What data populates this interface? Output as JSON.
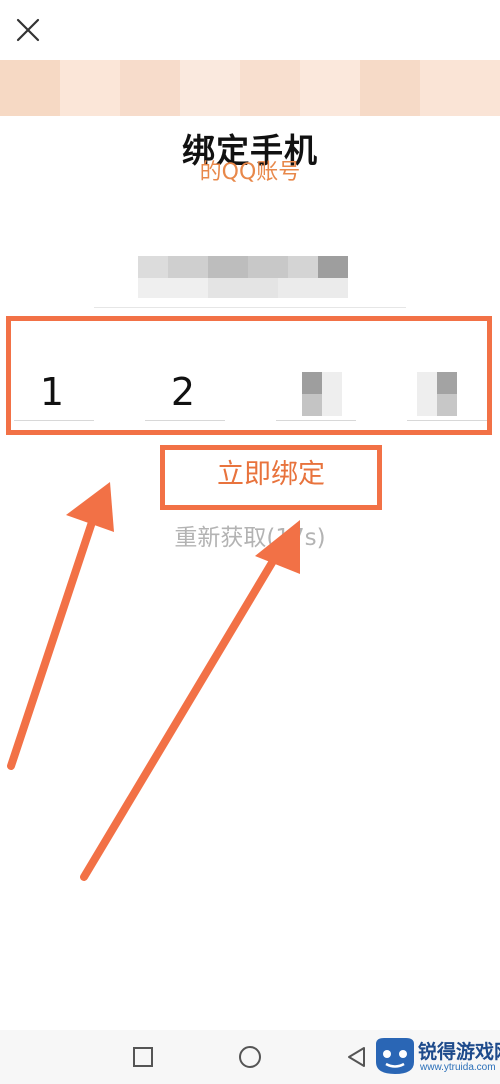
{
  "header": {
    "title": "绑定手机",
    "subtitle": "的QQ账号"
  },
  "code": {
    "digits": [
      "1",
      "2",
      "",
      ""
    ]
  },
  "actions": {
    "bind_label": "立即绑定",
    "resend_label": "重新获取(17s)"
  },
  "watermark": {
    "title": "锐得游戏网",
    "url": "www.ytruida.com"
  },
  "colors": {
    "accent": "#e8733d",
    "annotation": "#f27146",
    "subtitle": "#e8884a"
  },
  "icons": {
    "close": "close-icon",
    "home": "square-icon",
    "recent": "circle-icon",
    "back": "triangle-back-icon"
  }
}
